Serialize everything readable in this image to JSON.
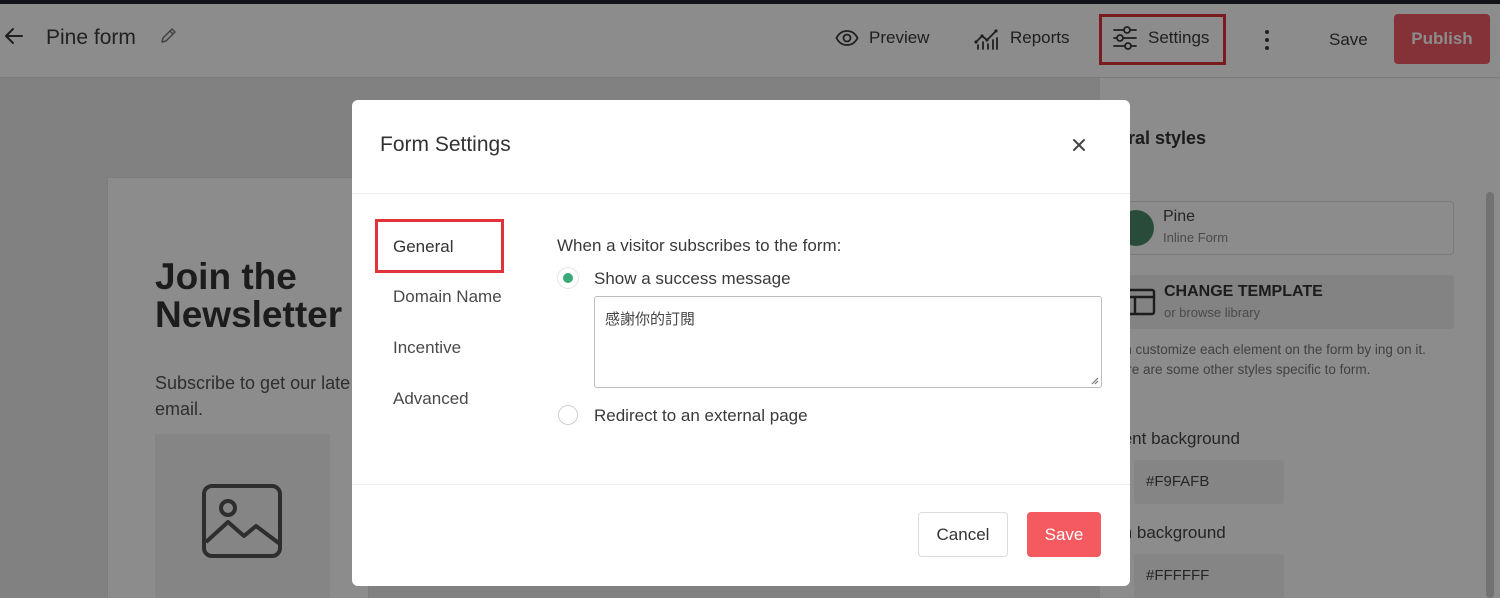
{
  "header": {
    "form_title": "Pine form",
    "nav": {
      "preview": "Preview",
      "reports": "Reports",
      "settings": "Settings",
      "save": "Save",
      "publish": "Publish"
    },
    "icons": [
      "back-arrow-icon",
      "pencil-icon",
      "eye-icon",
      "chart-icon",
      "sliders-icon",
      "more-vertical-icon"
    ]
  },
  "canvas": {
    "title": "Join the Newsletter",
    "subtitle": "Subscribe to get our late\nemail."
  },
  "right_panel": {
    "heading": "eral styles",
    "template": {
      "name": "Pine",
      "type": "Inline Form"
    },
    "change_template": {
      "title": "CHANGE TEMPLATE",
      "subtitle": "or browse library"
    },
    "description": "can customize each element on the form by ing on it. Here are some other styles specific to form.",
    "content_background": {
      "label": "tent background",
      "value": "#F9FAFB"
    },
    "form_background": {
      "label": "m background",
      "value": "#FFFFFF"
    }
  },
  "modal": {
    "title": "Form Settings",
    "tabs": [
      {
        "label": "General",
        "active": true
      },
      {
        "label": "Domain Name",
        "active": false
      },
      {
        "label": "Incentive",
        "active": false
      },
      {
        "label": "Advanced",
        "active": false
      }
    ],
    "section_label": "When a visitor subscribes to the form:",
    "options": [
      {
        "label": "Show a success message",
        "selected": true
      },
      {
        "label": "Redirect to an external page",
        "selected": false
      }
    ],
    "success_message": "感謝你的訂閱",
    "cancel_label": "Cancel",
    "save_label": "Save"
  },
  "colors": {
    "accent_red": "#f45a5f",
    "highlight_red": "#e2323a",
    "radio_green": "#3aa97a"
  }
}
